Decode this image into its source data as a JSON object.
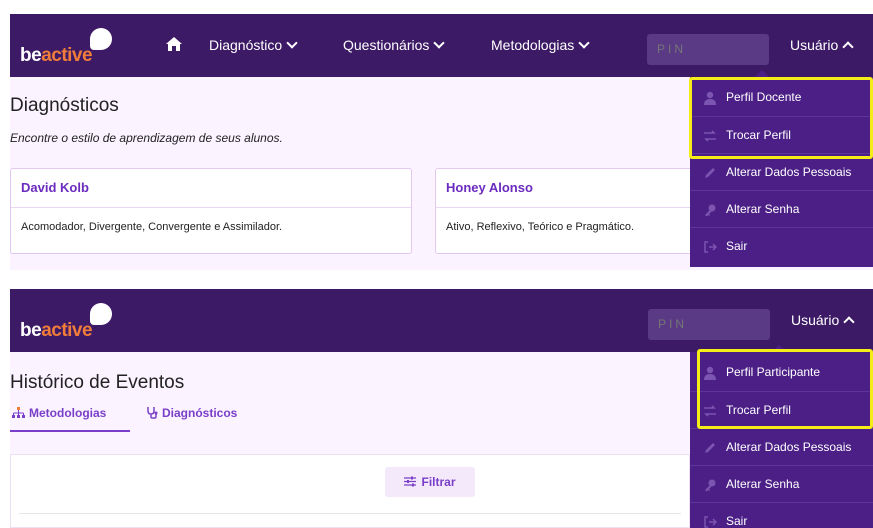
{
  "brand": {
    "be": "be",
    "active": "active"
  },
  "screen1": {
    "nav": {
      "items": [
        {
          "label": "Diagnóstico"
        },
        {
          "label": "Questionários"
        },
        {
          "label": "Metodologias"
        }
      ],
      "pin_placeholder": "PIN",
      "user_label": "Usuário"
    },
    "page_title": "Diagnósticos",
    "subtitle": "Encontre o estilo de aprendizagem de seus alunos.",
    "cards": [
      {
        "title": "David Kolb",
        "desc": "Acomodador, Divergente, Convergente e Assimilador."
      },
      {
        "title": "Honey Alonso",
        "desc": "Ativo, Reflexivo, Teórico e Pragmático."
      }
    ],
    "menu": [
      {
        "label": "Perfil Docente",
        "icon": "user-icon"
      },
      {
        "label": "Trocar Perfil",
        "icon": "swap-icon"
      },
      {
        "label": "Alterar Dados Pessoais",
        "icon": "pencil-icon"
      },
      {
        "label": "Alterar Senha",
        "icon": "key-icon"
      },
      {
        "label": "Sair",
        "icon": "logout-icon"
      }
    ]
  },
  "screen2": {
    "nav": {
      "pin_placeholder": "PIN",
      "user_label": "Usuário"
    },
    "page_title": "Histórico de Eventos",
    "tabs": [
      {
        "label": "Metodologias",
        "icon": "hierarchy-icon"
      },
      {
        "label": "Diagnósticos",
        "icon": "stethoscope-icon"
      }
    ],
    "filter_label": "Filtrar",
    "menu": [
      {
        "label": "Perfil Participante",
        "icon": "user-icon"
      },
      {
        "label": "Trocar Perfil",
        "icon": "swap-icon"
      },
      {
        "label": "Alterar Dados Pessoais",
        "icon": "pencil-icon"
      },
      {
        "label": "Alterar Senha",
        "icon": "key-icon"
      },
      {
        "label": "Sair",
        "icon": "logout-icon"
      }
    ]
  },
  "colors": {
    "navbar": "#3d1a66",
    "dropdown": "#4b1f86",
    "accent": "#7a3fc8",
    "brand_orange": "#f07c3a",
    "highlight": "#f5ec18"
  }
}
